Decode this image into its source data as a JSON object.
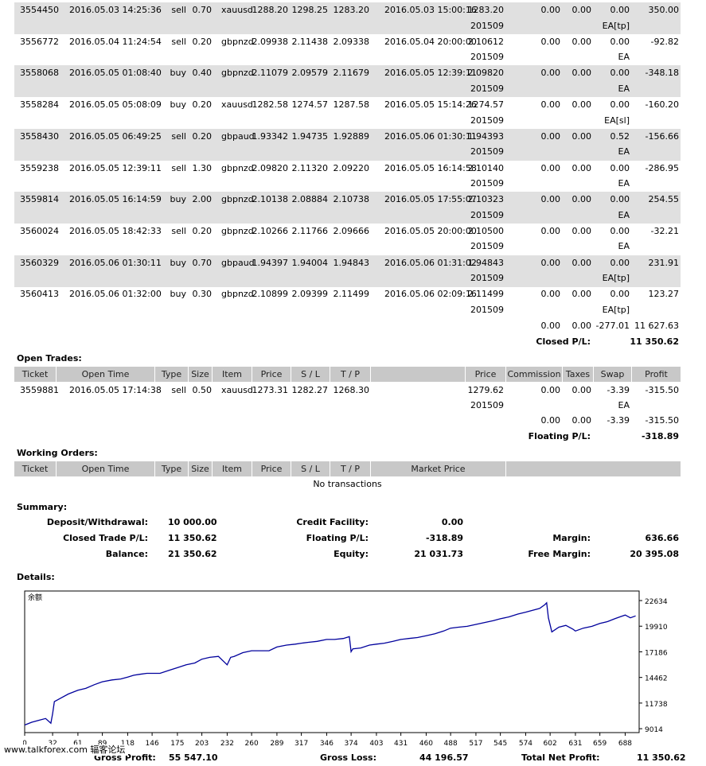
{
  "closed_trades": [
    {
      "ticket": "3554450",
      "open_time": "2016.05.03 14:25:36",
      "type": "sell",
      "size": "0.70",
      "item": "xauusd",
      "price": "1288.20",
      "sl": "1298.25",
      "tp": "1283.20",
      "close_time": "2016.05.03 15:00:16",
      "close_price": "1283.20",
      "commission": "0.00",
      "taxes": "0.00",
      "swap": "0.00",
      "profit": "350.00",
      "sub": "201509",
      "comment": "EA[tp]"
    },
    {
      "ticket": "3556772",
      "open_time": "2016.05.04 11:24:54",
      "type": "sell",
      "size": "0.20",
      "item": "gbpnzd",
      "price": "2.09938",
      "sl": "2.11438",
      "tp": "2.09338",
      "close_time": "2016.05.04 20:00:00",
      "close_price": "2.10612",
      "commission": "0.00",
      "taxes": "0.00",
      "swap": "0.00",
      "profit": "-92.82",
      "sub": "201509",
      "comment": "EA"
    },
    {
      "ticket": "3558068",
      "open_time": "2016.05.05 01:08:40",
      "type": "buy",
      "size": "0.40",
      "item": "gbpnzd",
      "price": "2.11079",
      "sl": "2.09579",
      "tp": "2.11679",
      "close_time": "2016.05.05 12:39:11",
      "close_price": "2.09820",
      "commission": "0.00",
      "taxes": "0.00",
      "swap": "0.00",
      "profit": "-348.18",
      "sub": "201509",
      "comment": "EA"
    },
    {
      "ticket": "3558284",
      "open_time": "2016.05.05 05:08:09",
      "type": "buy",
      "size": "0.20",
      "item": "xauusd",
      "price": "1282.58",
      "sl": "1274.57",
      "tp": "1287.58",
      "close_time": "2016.05.05 15:14:26",
      "close_price": "1274.57",
      "commission": "0.00",
      "taxes": "0.00",
      "swap": "0.00",
      "profit": "-160.20",
      "sub": "201509",
      "comment": "EA[sl]"
    },
    {
      "ticket": "3558430",
      "open_time": "2016.05.05 06:49:25",
      "type": "sell",
      "size": "0.20",
      "item": "gbpaud",
      "price": "1.93342",
      "sl": "1.94735",
      "tp": "1.92889",
      "close_time": "2016.05.06 01:30:11",
      "close_price": "1.94393",
      "commission": "0.00",
      "taxes": "0.00",
      "swap": "0.52",
      "profit": "-156.66",
      "sub": "201509",
      "comment": "EA"
    },
    {
      "ticket": "3559238",
      "open_time": "2016.05.05 12:39:11",
      "type": "sell",
      "size": "1.30",
      "item": "gbpnzd",
      "price": "2.09820",
      "sl": "2.11320",
      "tp": "2.09220",
      "close_time": "2016.05.05 16:14:58",
      "close_price": "2.10140",
      "commission": "0.00",
      "taxes": "0.00",
      "swap": "0.00",
      "profit": "-286.95",
      "sub": "201509",
      "comment": "EA"
    },
    {
      "ticket": "3559814",
      "open_time": "2016.05.05 16:14:59",
      "type": "buy",
      "size": "2.00",
      "item": "gbpnzd",
      "price": "2.10138",
      "sl": "2.08884",
      "tp": "2.10738",
      "close_time": "2016.05.05 17:55:07",
      "close_price": "2.10323",
      "commission": "0.00",
      "taxes": "0.00",
      "swap": "0.00",
      "profit": "254.55",
      "sub": "201509",
      "comment": "EA"
    },
    {
      "ticket": "3560024",
      "open_time": "2016.05.05 18:42:33",
      "type": "sell",
      "size": "0.20",
      "item": "gbpnzd",
      "price": "2.10266",
      "sl": "2.11766",
      "tp": "2.09666",
      "close_time": "2016.05.05 20:00:00",
      "close_price": "2.10500",
      "commission": "0.00",
      "taxes": "0.00",
      "swap": "0.00",
      "profit": "-32.21",
      "sub": "201509",
      "comment": "EA"
    },
    {
      "ticket": "3560329",
      "open_time": "2016.05.06 01:30:11",
      "type": "buy",
      "size": "0.70",
      "item": "gbpaud",
      "price": "1.94397",
      "sl": "1.94004",
      "tp": "1.94843",
      "close_time": "2016.05.06 01:31:02",
      "close_price": "1.94843",
      "commission": "0.00",
      "taxes": "0.00",
      "swap": "0.00",
      "profit": "231.91",
      "sub": "201509",
      "comment": "EA[tp]"
    },
    {
      "ticket": "3560413",
      "open_time": "2016.05.06 01:32:00",
      "type": "buy",
      "size": "0.30",
      "item": "gbpnzd",
      "price": "2.10899",
      "sl": "2.09399",
      "tp": "2.11499",
      "close_time": "2016.05.06 02:09:16",
      "close_price": "2.11499",
      "commission": "0.00",
      "taxes": "0.00",
      "swap": "0.00",
      "profit": "123.27",
      "sub": "201509",
      "comment": "EA[tp]"
    }
  ],
  "closed_totals": {
    "commission": "0.00",
    "taxes": "0.00",
    "swap": "-277.01",
    "profit": "11 627.63",
    "pl_label": "Closed P/L:",
    "pl_value": "11 350.62"
  },
  "open_trades": {
    "title": "Open Trades:",
    "headers": {
      "ticket": "Ticket",
      "open_time": "Open Time",
      "type": "Type",
      "size": "Size",
      "item": "Item",
      "price": "Price",
      "sl": "S / L",
      "tp": "T / P",
      "price2": "Price",
      "commission": "Commission",
      "taxes": "Taxes",
      "swap": "Swap",
      "profit": "Profit"
    },
    "row": {
      "ticket": "3559881",
      "open_time": "2016.05.05 17:14:38",
      "type": "sell",
      "size": "0.50",
      "item": "xauusd",
      "price": "1273.31",
      "sl": "1282.27",
      "tp": "1268.30",
      "price2": "1279.62",
      "commission": "0.00",
      "taxes": "0.00",
      "swap": "-3.39",
      "profit": "-315.50",
      "sub": "201509",
      "comment": "EA"
    },
    "totals": {
      "commission": "0.00",
      "taxes": "0.00",
      "swap": "-3.39",
      "profit": "-315.50"
    },
    "pl_label": "Floating P/L:",
    "pl_value": "-318.89"
  },
  "working_orders": {
    "title": "Working Orders:",
    "headers": {
      "ticket": "Ticket",
      "open_time": "Open Time",
      "type": "Type",
      "size": "Size",
      "item": "Item",
      "price": "Price",
      "sl": "S / L",
      "tp": "T / P",
      "market_price": "Market Price"
    },
    "empty": "No transactions"
  },
  "summary": {
    "title": "Summary:",
    "deposit_label": "Deposit/Withdrawal:",
    "deposit": "10 000.00",
    "credit_label": "Credit Facility:",
    "credit": "0.00",
    "closed_label": "Closed Trade P/L:",
    "closed": "11 350.62",
    "floating_label": "Floating P/L:",
    "floating": "-318.89",
    "margin_label": "Margin:",
    "margin": "636.66",
    "balance_label": "Balance:",
    "balance": "21 350.62",
    "equity_label": "Equity:",
    "equity": "21 031.73",
    "free_margin_label": "Free Margin:",
    "free_margin": "20 395.08"
  },
  "details": {
    "title": "Details:"
  },
  "chart_data": {
    "type": "line",
    "title": "余额",
    "color": "#00009c",
    "x_ticks": [
      "0",
      "32",
      "61",
      "89",
      "118",
      "146",
      "175",
      "203",
      "232",
      "260",
      "289",
      "317",
      "346",
      "374",
      "403",
      "431",
      "460",
      "488",
      "517",
      "545",
      "574",
      "602",
      "631",
      "659",
      "688"
    ],
    "y_ticks": [
      "22634",
      "19910",
      "17186",
      "14462",
      "11738",
      "9014"
    ],
    "xlim": [
      0,
      704
    ],
    "ylim": [
      8600,
      23650
    ],
    "x": [
      0,
      8,
      16,
      24,
      30,
      32,
      34,
      40,
      50,
      61,
      70,
      80,
      89,
      100,
      110,
      118,
      125,
      132,
      140,
      146,
      155,
      165,
      175,
      185,
      195,
      203,
      212,
      222,
      232,
      236,
      240,
      250,
      260,
      270,
      280,
      289,
      300,
      310,
      317,
      325,
      335,
      346,
      355,
      365,
      372,
      374,
      376,
      385,
      395,
      403,
      412,
      422,
      431,
      440,
      450,
      460,
      470,
      480,
      488,
      497,
      507,
      517,
      527,
      537,
      545,
      555,
      565,
      574,
      582,
      590,
      596,
      598,
      600,
      604,
      612,
      620,
      628,
      631,
      640,
      650,
      659,
      668,
      676,
      682,
      688,
      694,
      700
    ],
    "y": [
      9400,
      9700,
      9900,
      10100,
      9600,
      10600,
      11900,
      12200,
      12700,
      13100,
      13300,
      13700,
      14000,
      14200,
      14300,
      14500,
      14700,
      14800,
      14900,
      14900,
      14900,
      15200,
      15500,
      15800,
      16000,
      16400,
      16600,
      16700,
      15800,
      16600,
      16700,
      17100,
      17300,
      17300,
      17300,
      17700,
      17900,
      18000,
      18100,
      18200,
      18300,
      18500,
      18500,
      18600,
      18800,
      17200,
      17500,
      17600,
      17900,
      18000,
      18100,
      18300,
      18500,
      18600,
      18700,
      18900,
      19100,
      19400,
      19700,
      19800,
      19900,
      20100,
      20300,
      20500,
      20700,
      20900,
      21200,
      21400,
      21600,
      21800,
      22200,
      22400,
      20800,
      19300,
      19800,
      20000,
      19600,
      19400,
      19700,
      19900,
      20200,
      20400,
      20700,
      20900,
      21100,
      20800,
      21000
    ]
  },
  "footer": {
    "site": "www.talkforex.com 辐客论坛",
    "cut1": "Gross Profit:",
    "cut1v": "55 547.10",
    "cut2": "Gross Loss:",
    "cut2v": "44 196.57",
    "cut3": "Total Net Profit:",
    "cut3v": "11 350.62"
  }
}
